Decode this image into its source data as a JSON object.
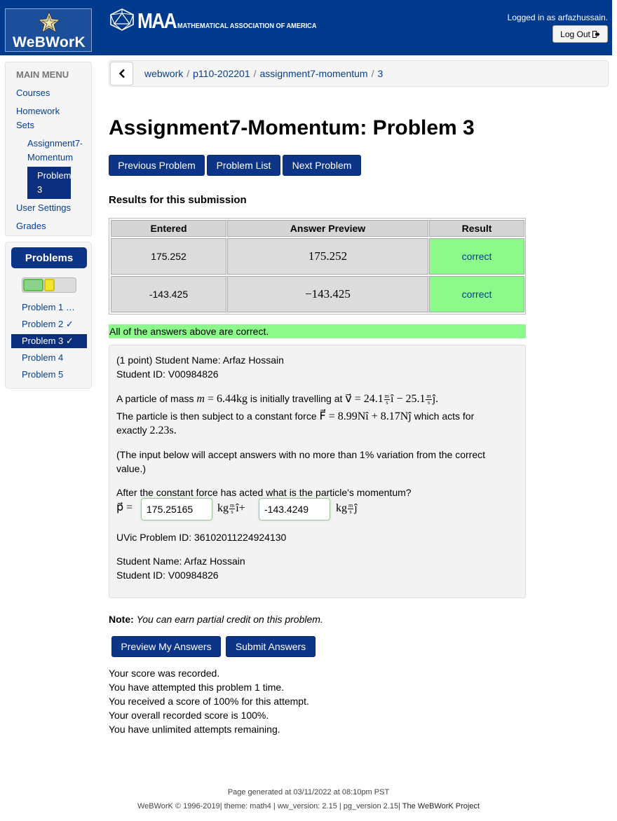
{
  "header": {
    "webwork_logo": "WeBWorK",
    "maa_big": "MAA",
    "maa_small": "MATHEMATICAL ASSOCIATION OF AMERICA",
    "logged_in_text": "Logged in as arfazhussain.",
    "logout_label": "Log Out"
  },
  "main_menu": {
    "title": "MAIN MENU",
    "courses": "Courses",
    "homework_line1": "Homework",
    "homework_line2": "Sets",
    "assignment_line1": "Assignment7-",
    "assignment_line2": "Momentum",
    "problem_line1": "Problem",
    "problem_line2": "3",
    "user_settings": "User Settings",
    "grades": "Grades"
  },
  "problems_nav": {
    "title": "Problems",
    "items": [
      "Problem 1 …",
      "Problem 2 ✓",
      "Problem 3 ✓",
      "Problem 4",
      "Problem 5"
    ]
  },
  "breadcrumb": {
    "items": [
      "webwork",
      "p110-202201",
      "assignment7-momentum",
      "3"
    ],
    "separator": "/"
  },
  "page_title": "Assignment7-Momentum: Problem 3",
  "nav_buttons": {
    "previous": "Previous Problem",
    "list": "Problem List",
    "next": "Next Problem"
  },
  "results": {
    "heading": "Results for this submission",
    "headers": [
      "Entered",
      "Answer Preview",
      "Result"
    ],
    "rows": [
      {
        "entered": "175.252",
        "preview": "175.252",
        "result": "correct"
      },
      {
        "entered": "-143.425",
        "preview": "−143.425",
        "result": "correct"
      }
    ],
    "summary": "All of the answers above are correct."
  },
  "problem": {
    "intro_line1": "(1 point) Student Name: Arfaz Hossain",
    "intro_line2": "Student ID: V00984826",
    "p1_a": "A particle of mass ",
    "p1_m": "m",
    "p1_b": " = 6.44kg",
    "p1_c": " is initially travelling at ",
    "p1_v": "v⃗ = 24.1",
    "p1_v2": "î − 25.1",
    "p1_v3": "ĵ.",
    "p2_a": "The particle is then subject to a constant force ",
    "p2_f": "F⃗ = 8.99Nî + 8.17Nĵ",
    "p2_b": " which acts for",
    "p3_a": "exactly ",
    "p3_t": "2.23s.",
    "tolerance_line1": "(The input below will accept answers with no more than 1% variation from the correct",
    "tolerance_line2": "value.)",
    "question": "After the constant force has acted what is the particle's momentum?",
    "p_label": "p⃗ =",
    "unit_kg": "kg",
    "unit_m": "m",
    "unit_s": "s",
    "unit_i": "î+",
    "unit_j": "ĵ",
    "answer1": "175.25165",
    "answer2": "-143.4249",
    "uvic_id": "UVic Problem ID: 36102011224924130",
    "footer_name": "Student Name: Arfaz Hossain",
    "footer_id": "Student ID: V00984826"
  },
  "note": {
    "label": "Note:",
    "text": "You can earn partial credit on this problem."
  },
  "submit_buttons": {
    "preview": "Preview My Answers",
    "submit": "Submit Answers"
  },
  "score_messages": [
    "Your score was recorded.",
    "You have attempted this problem 1 time.",
    "You received a score of 100% for this attempt.",
    "Your overall recorded score is 100%.",
    "You have unlimited attempts remaining."
  ],
  "footer": {
    "generated": "Page generated at 03/11/2022 at 08:10pm PST",
    "copyright": "WeBWorK © 1996-2019| theme: math4 | ww_version: 2.15 | pg_version 2.15|",
    "project": "The WeBWorK Project"
  },
  "colors": {
    "header_blue": "#003a8c",
    "button_blue": "#0d3587",
    "correct_green": "#8cf98b",
    "link_blue": "#063e8c"
  },
  "icons": {
    "logout": "sign-out-icon",
    "back": "chevron-left-icon",
    "webwork": "webwork-star-icon",
    "maa": "maa-icosahedron-icon"
  }
}
